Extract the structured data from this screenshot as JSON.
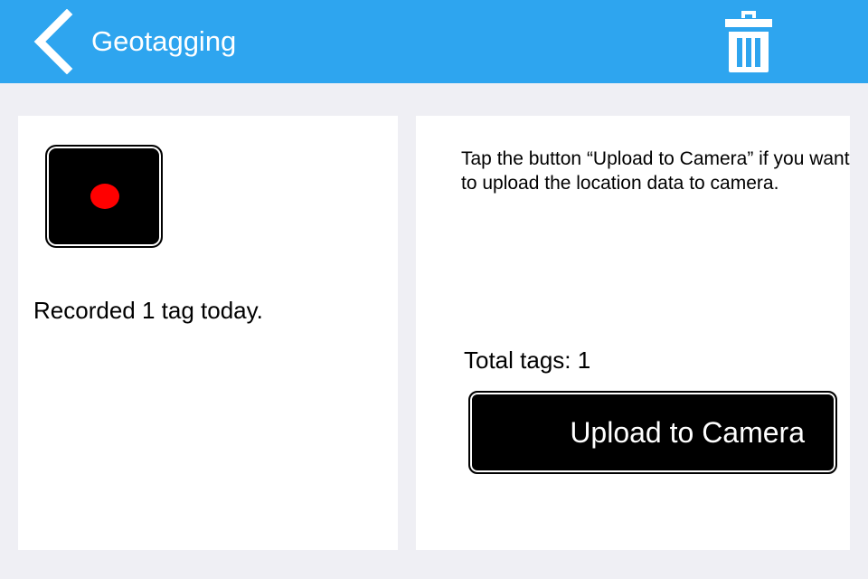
{
  "header": {
    "back_icon": "chevron-left-icon",
    "title": "Geotagging",
    "trash_icon": "trash-icon",
    "background_color": "#2ea5ef"
  },
  "left_panel": {
    "record_icon": "record-dot-icon",
    "record_dot_color": "#ff0000",
    "recorded_text": "Recorded 1 tag today."
  },
  "right_panel": {
    "instructions": "Tap the button “Upload to Camera” if you want to upload the location data to camera.",
    "total_tags": "Total tags: 1",
    "upload_label": "Upload to Camera"
  }
}
